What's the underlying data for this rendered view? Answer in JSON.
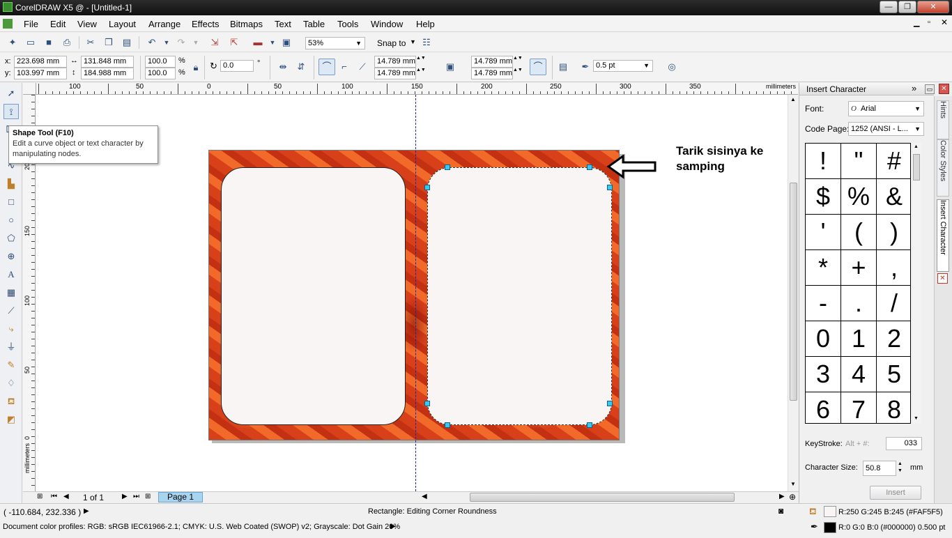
{
  "window": {
    "title": "CorelDRAW X5 @ - [Untitled-1]",
    "min_label": "—",
    "max_label": "❐",
    "close_label": "✕"
  },
  "menu": [
    "File",
    "Edit",
    "View",
    "Layout",
    "Arrange",
    "Effects",
    "Bitmaps",
    "Text",
    "Table",
    "Tools",
    "Window",
    "Help"
  ],
  "toolbar": {
    "zoom": "53%",
    "snap": "Snap to"
  },
  "property_bar": {
    "x": "223.698 mm",
    "y": "103.997 mm",
    "x_label": "x:",
    "y_label": "y:",
    "width": "131.848 mm",
    "height": "184.988 mm",
    "scale_w": "100.0",
    "scale_h": "100.0",
    "pct": "%",
    "angle": "0.0",
    "degree": "°",
    "corner_tl": "14.789 mm",
    "corner_bl": "14.789 mm",
    "corner_tr": "14.789 mm",
    "corner_br": "14.789 mm",
    "outline": "0.5 pt"
  },
  "tooltip": {
    "title": "Shape Tool (F10)",
    "body1": "Edit a curve object or text character by",
    "body2": "manipulating nodes."
  },
  "ruler": {
    "unit": "millimeters",
    "top_ticks": [
      "100",
      "50",
      "0",
      "50",
      "100",
      "150",
      "200",
      "250",
      "300",
      "350"
    ],
    "left_ticks": [
      "200",
      "150",
      "100",
      "50",
      "0"
    ],
    "left_unit": "millimeters"
  },
  "annotation": {
    "line1": "Tarik sisinya ke",
    "line2": "samping"
  },
  "pagebar": {
    "page_count": "1 of 1",
    "tab": "Page 1"
  },
  "docker": {
    "title": "Insert Character",
    "font_label": "Font:",
    "font_value": "Arial",
    "codepage_label": "Code Page:",
    "codepage_value": "1252  (ANSI - L...",
    "characters": [
      "!",
      "\"",
      "#",
      "$",
      "%",
      "&",
      "'",
      "(",
      ")",
      "*",
      "+",
      ",",
      "-",
      ".",
      "/",
      "0",
      "1",
      "2",
      "3",
      "4",
      "5",
      "6",
      "7",
      "8"
    ],
    "keystroke_label": "KeyStroke:",
    "keystroke_hint": "Alt + #:",
    "keystroke_value": "033",
    "size_label": "Character Size:",
    "size_value": "50.8",
    "size_unit": "mm",
    "insert_button": "Insert"
  },
  "docker_tabs": [
    "Hints",
    "Color Styles",
    "Insert Character"
  ],
  "status": {
    "coords": "( -110.684, 232.336 )",
    "message": "Rectangle: Editing Corner Roundness",
    "profiles": "Document color profiles: RGB: sRGB IEC61966-2.1; CMYK: U.S. Web Coated (SWOP) v2; Grayscale: Dot Gain 20%",
    "fill": "R:250 G:245 B:245 (#FAF5F5)",
    "outline": "R:0 G:0 B:0 (#000000)  0.500 pt",
    "fill_color": "#FAF5F5",
    "outline_color": "#000000"
  },
  "colors": {
    "card_fill": "#FAF5F5",
    "background_orange": "#E0461A",
    "guide": "#2222aa",
    "selection": "#39c8f2"
  }
}
